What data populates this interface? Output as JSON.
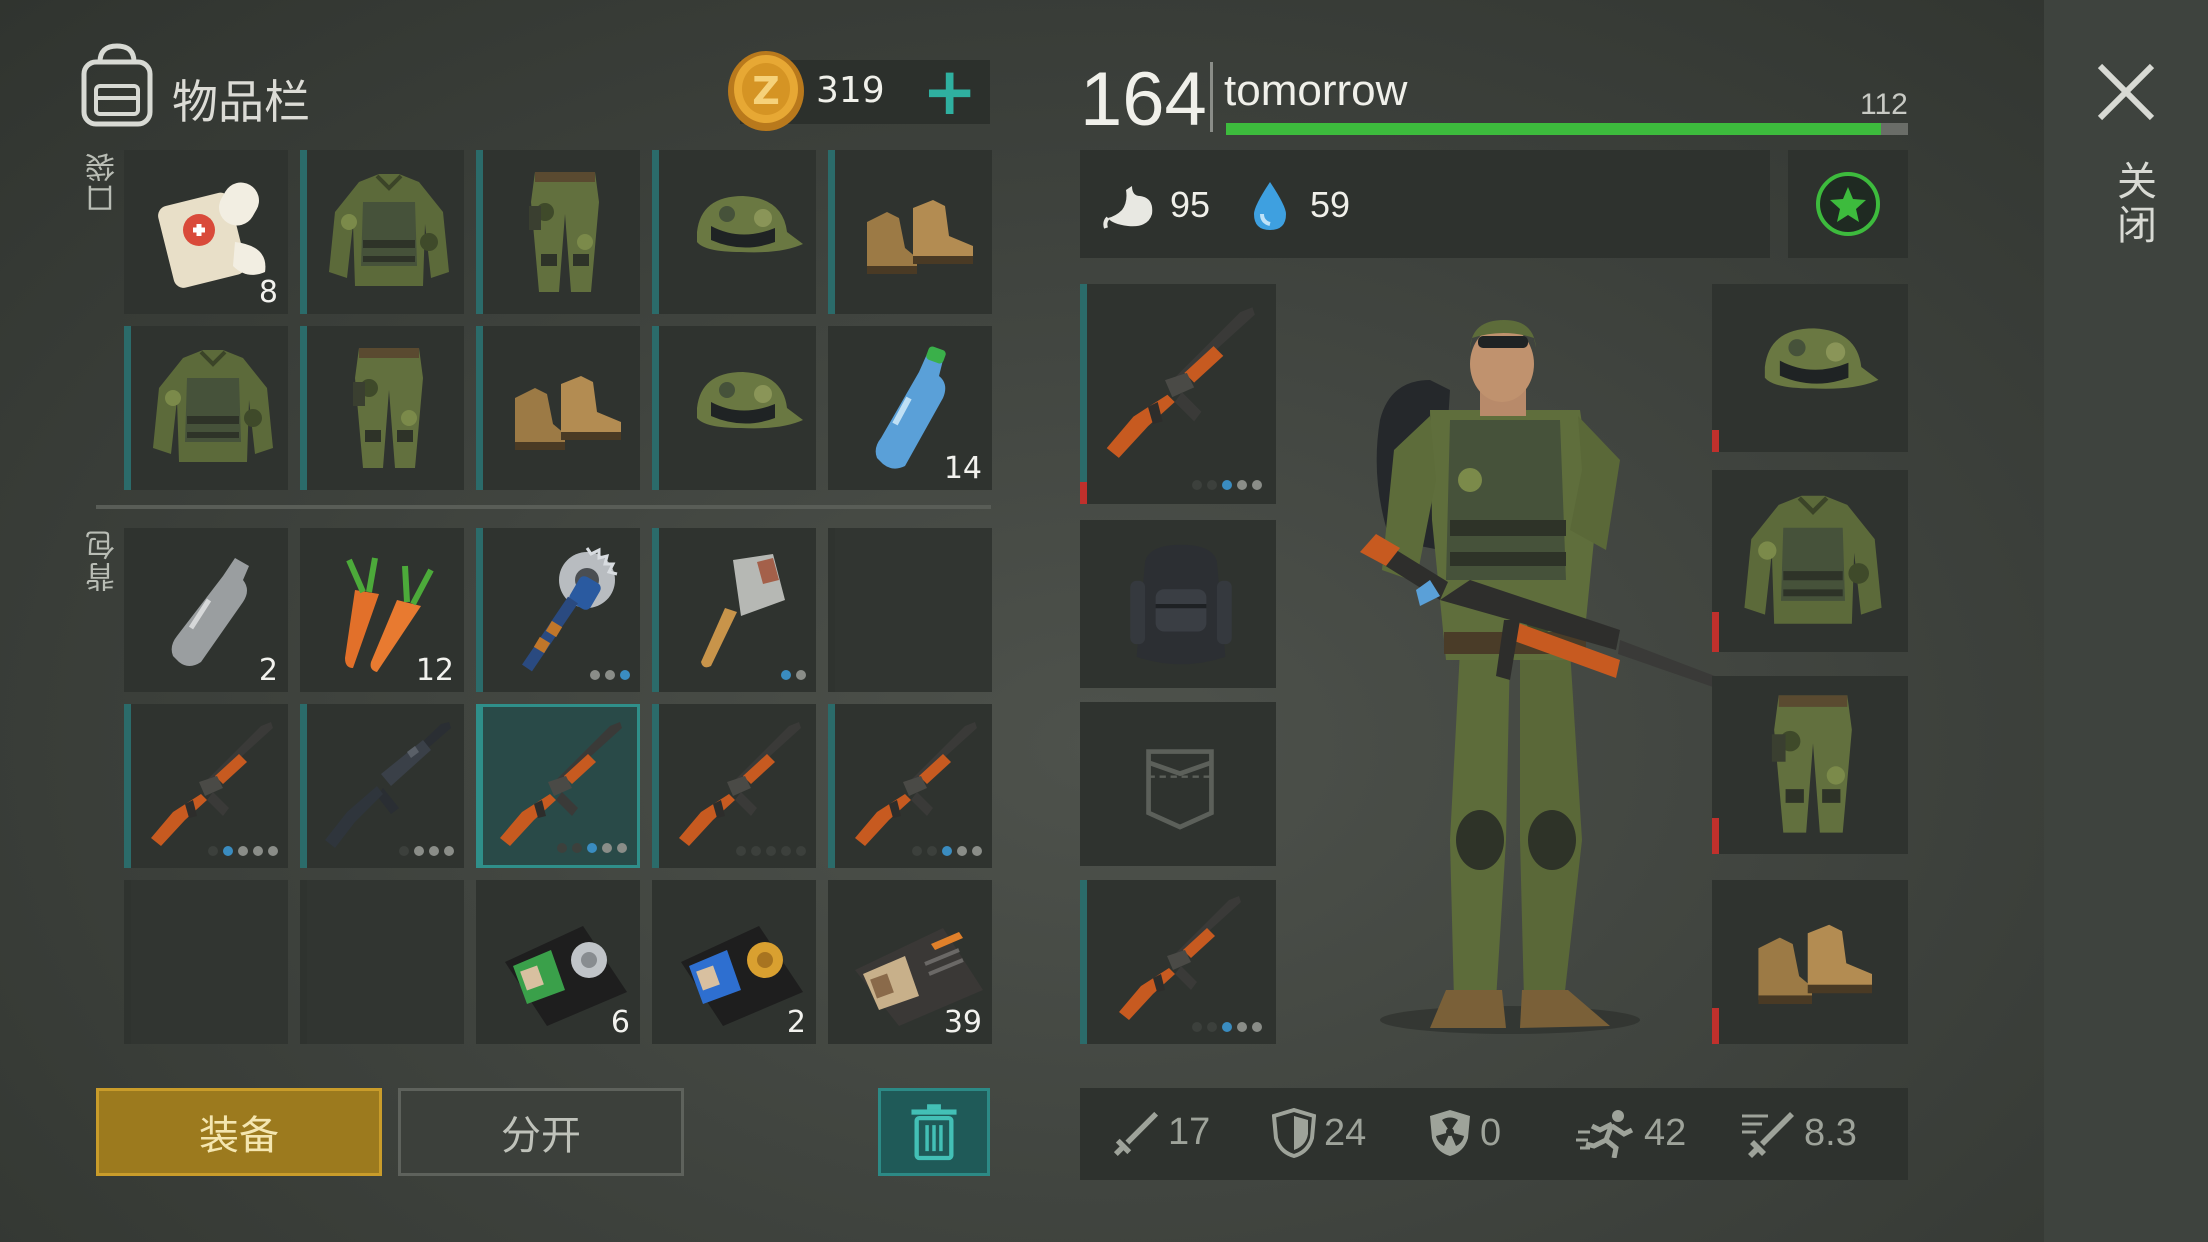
{
  "inventory": {
    "title": "物品栏",
    "coins": "319",
    "add_label": "+",
    "pocket_label": "口袋",
    "backpack_label": "背包",
    "pocket_items": [
      {
        "name": "bandage",
        "count": "8"
      },
      {
        "name": "camo-jacket",
        "count": ""
      },
      {
        "name": "camo-pants",
        "count": ""
      },
      {
        "name": "camo-cap",
        "count": ""
      },
      {
        "name": "boots",
        "count": ""
      },
      {
        "name": "camo-jacket",
        "count": ""
      },
      {
        "name": "camo-pants",
        "count": ""
      },
      {
        "name": "boots",
        "count": ""
      },
      {
        "name": "camo-cap",
        "count": ""
      },
      {
        "name": "water-bottle",
        "count": "14"
      }
    ],
    "backpack_items": [
      {
        "name": "empty-bottle",
        "count": "2"
      },
      {
        "name": "carrots",
        "count": "12"
      },
      {
        "name": "saw-mace",
        "count": ""
      },
      {
        "name": "cleaver",
        "count": ""
      },
      {
        "name": "empty",
        "count": ""
      },
      {
        "name": "ak47",
        "count": ""
      },
      {
        "name": "m16",
        "count": ""
      },
      {
        "name": "ak47",
        "count": ""
      },
      {
        "name": "ak47",
        "count": ""
      },
      {
        "name": "ak47",
        "count": ""
      },
      {
        "name": "empty",
        "count": ""
      },
      {
        "name": "empty",
        "count": ""
      },
      {
        "name": "police-badge-green",
        "count": "6"
      },
      {
        "name": "police-badge-blue",
        "count": "2"
      },
      {
        "name": "patrol-id-wallet",
        "count": "39"
      }
    ],
    "equip_label": "装备",
    "split_label": "分开"
  },
  "character": {
    "level": "164",
    "name": "tomorrow",
    "xp_value": "112",
    "xp_progress": 0.96,
    "hunger": "95",
    "thirst": "59",
    "close_label": "关闭"
  },
  "stats": {
    "attack": "17",
    "defense": "24",
    "toxic_defense": "0",
    "speed": "42",
    "attack_speed": "8.3"
  },
  "colors": {
    "accent_teal": "#2b6b6a",
    "equip_gold": "#b8902a",
    "health_green": "#3dbb3d",
    "durability_red": "#c0302c"
  }
}
